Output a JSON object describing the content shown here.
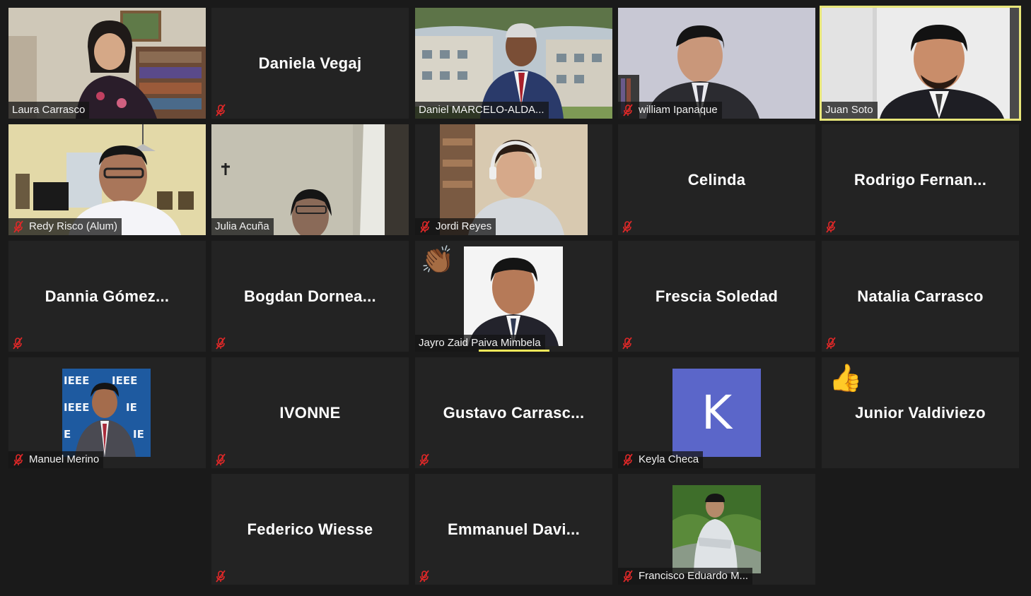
{
  "participants": [
    {
      "name": "Laura Carrasco",
      "mic_muted": false,
      "video": "room-bookshelf"
    },
    {
      "name": "Daniela Vegaj",
      "mic_muted": true,
      "video": null
    },
    {
      "name": "Daniel MARCELO-ALDA...",
      "mic_muted": false,
      "video": "campus-man"
    },
    {
      "name": "william Ipanaque",
      "mic_muted": true,
      "video": "office-man"
    },
    {
      "name": "Juan Soto",
      "mic_muted": false,
      "video": "wall-man",
      "speaking": true
    },
    {
      "name": "Redy Risco (Alum)",
      "mic_muted": true,
      "video": "room-man"
    },
    {
      "name": "Julia Acuña",
      "mic_muted": false,
      "video": "dim-room"
    },
    {
      "name": "Jordi Reyes",
      "mic_muted": true,
      "video": "headset-man"
    },
    {
      "name": "Celinda",
      "mic_muted": true,
      "video": null
    },
    {
      "name": "Rodrigo Fernan...",
      "mic_muted": true,
      "video": null
    },
    {
      "name": "Dannia Gómez...",
      "mic_muted": true,
      "video": null
    },
    {
      "name": "Bogdan Dornea...",
      "mic_muted": true,
      "video": null
    },
    {
      "name": "Jayro Zaid Paiva Mimbela",
      "mic_muted": false,
      "video": "portrait",
      "reaction": "clap"
    },
    {
      "name": "Frescia Soledad",
      "mic_muted": true,
      "video": null
    },
    {
      "name": "Natalia Carrasco",
      "mic_muted": true,
      "video": null
    },
    {
      "name": "Manuel Merino",
      "mic_muted": true,
      "video": "ieee-portrait"
    },
    {
      "name": "IVONNE",
      "mic_muted": true,
      "video": null
    },
    {
      "name": "Gustavo Carrasc...",
      "mic_muted": true,
      "video": null
    },
    {
      "name": "Keyla Checa",
      "mic_muted": true,
      "video": "avatar-letter",
      "avatar_letter": "K"
    },
    {
      "name": "Junior Valdiviezo",
      "mic_muted": false,
      "video": null,
      "reaction": "thumbs-up"
    },
    {
      "name": "Federico Wiesse",
      "mic_muted": true,
      "video": null
    },
    {
      "name": "Emmanuel Davi...",
      "mic_muted": true,
      "video": null
    },
    {
      "name": "Francisco Eduardo M...",
      "mic_muted": true,
      "video": "nature-man"
    }
  ],
  "reactions": {
    "clap": "👏🏾",
    "thumbs-up": "👍"
  },
  "colors": {
    "background": "#1a1a1a",
    "tile": "#232323",
    "speaker_highlight": "#e8e67a",
    "mic_muted": "#e02828",
    "avatar_bg": "#5b66c9"
  },
  "icons": {
    "muted": "microphone-muted-icon"
  }
}
